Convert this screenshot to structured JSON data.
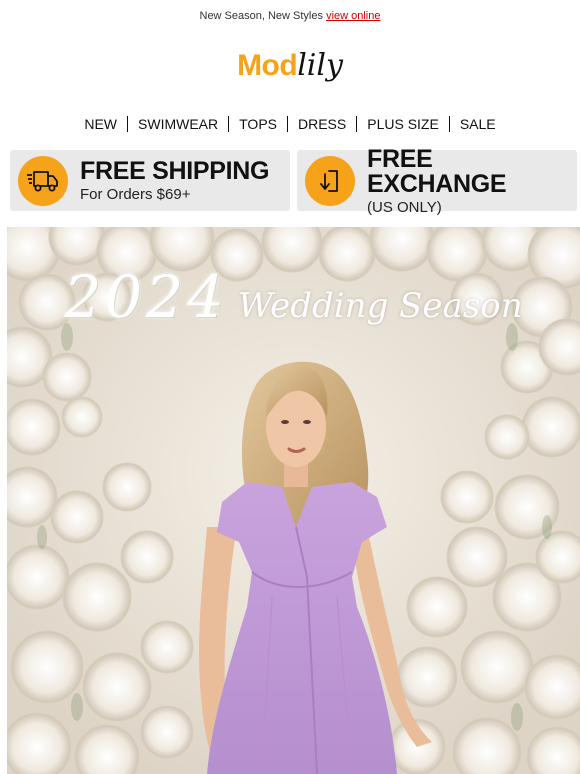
{
  "preheader": {
    "text": "New Season, New Styles ",
    "link": "view online"
  },
  "logo": {
    "part1": "Mod",
    "part2": "lily"
  },
  "nav": [
    "NEW",
    "SWIMWEAR",
    "TOPS",
    "DRESS",
    "PLUS SIZE",
    "SALE"
  ],
  "benefits": [
    {
      "icon": "delivery-truck-icon",
      "title": "FREE SHIPPING",
      "subtitle": "For Orders $69+"
    },
    {
      "icon": "exchange-arrow-icon",
      "title": "FREE EXCHANGE",
      "subtitle": "(US ONLY)"
    }
  ],
  "hero": {
    "year": "2024",
    "script": "Wedding Season"
  },
  "colors": {
    "brand_orange": "#f7a21b",
    "link_red": "#d40000",
    "benefit_bg": "#e9e9e9",
    "dress_lilac": "#c9a3dc"
  }
}
